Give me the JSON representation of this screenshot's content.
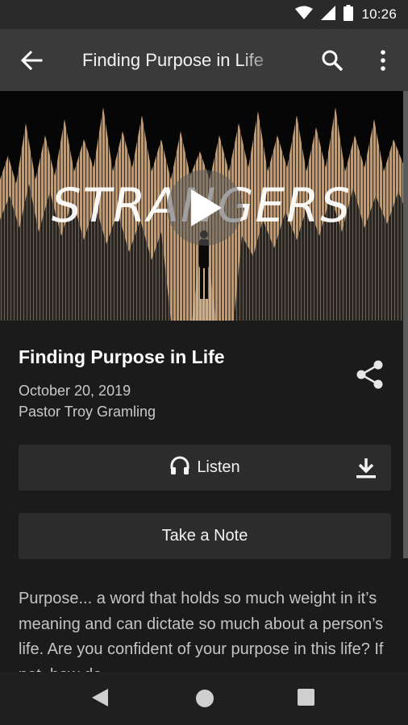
{
  "status_bar": {
    "time": "10:26",
    "icons": [
      "wifi-icon",
      "signal-icon",
      "battery-icon"
    ]
  },
  "app_bar": {
    "title": "Finding Purpose in Life",
    "icons": [
      "back-arrow-icon",
      "search-icon",
      "more-vert-icon"
    ]
  },
  "hero": {
    "artwork_text": "STRANGERS",
    "icon": "play-icon"
  },
  "sermon": {
    "title": "Finding Purpose in Life",
    "date": "October 20, 2019",
    "speaker": "Pastor Troy Gramling",
    "share_icon": "share-icon"
  },
  "actions": {
    "listen_label": "Listen",
    "listen_icon": "headphones-icon",
    "download_icon": "download-icon",
    "note_label": "Take a Note"
  },
  "description": "Purpose... a word that holds so much weight in it’s meaning and can dictate so much about a person’s life.  Are you confident of your purpose in this life? If not, how do",
  "colors": {
    "background": "#1b1b1c",
    "app_bar": "#3a3a3b",
    "button": "#2c2c2d",
    "artwork_accent": "#c49a6c"
  }
}
